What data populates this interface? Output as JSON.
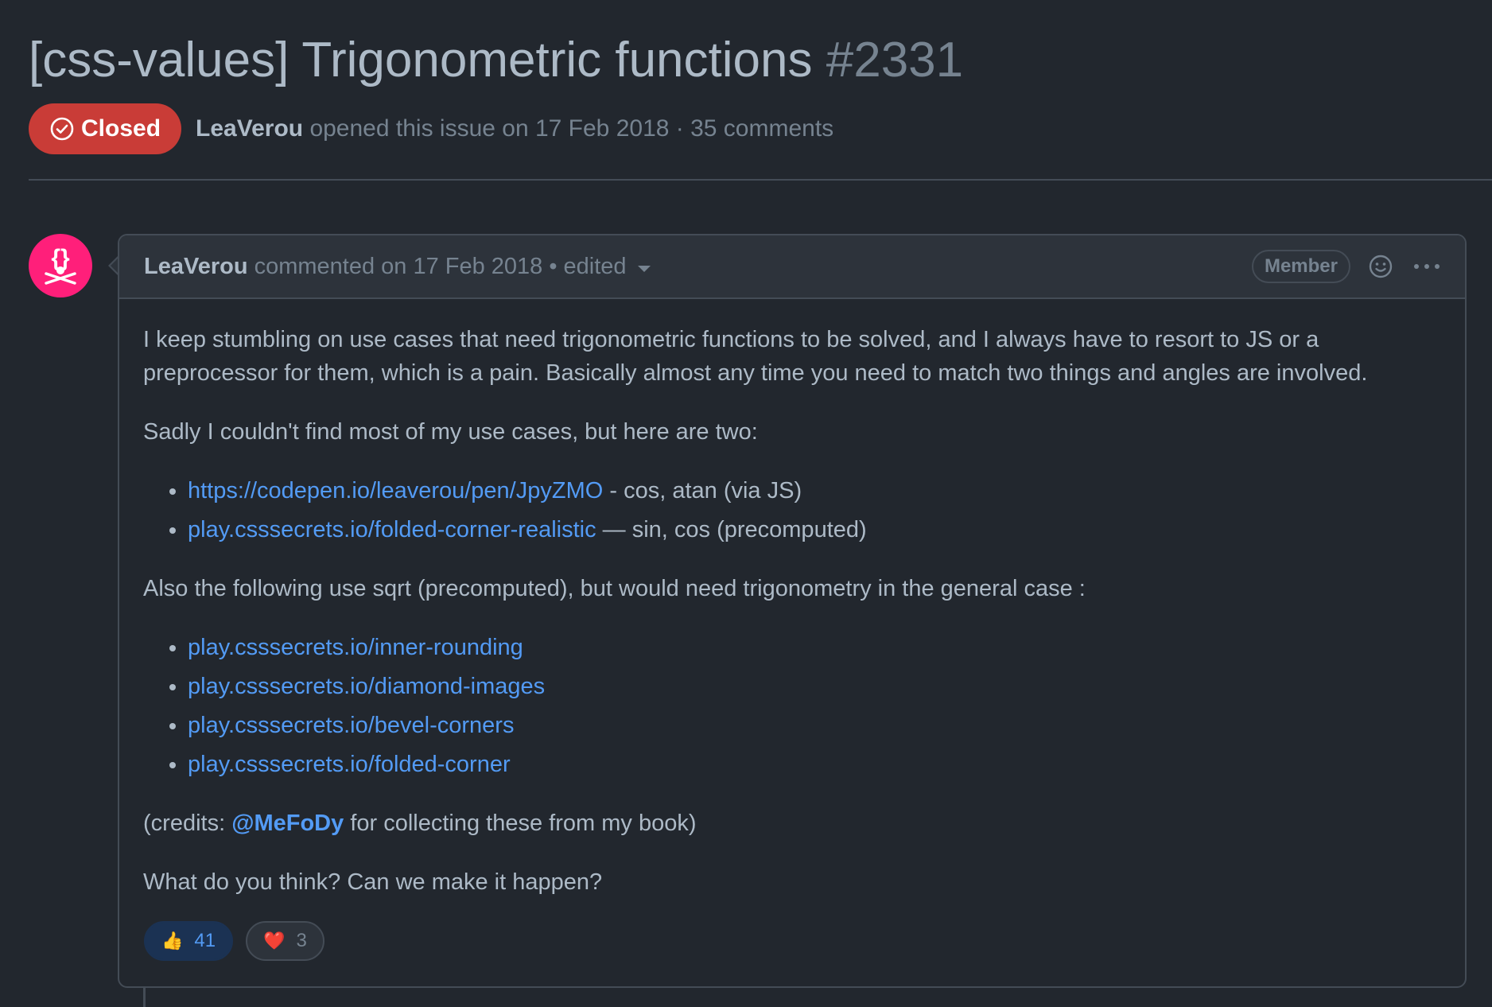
{
  "issue": {
    "title": "[css-values] Trigonometric functions",
    "number": "#2331",
    "state_label": "Closed",
    "author": "LeaVerou",
    "meta_text": "opened this issue on 17 Feb 2018 · 35 comments"
  },
  "comment": {
    "author": "LeaVerou",
    "timestamp": "commented on 17 Feb 2018",
    "edited_label": "• edited",
    "role_badge": "Member",
    "paragraph_1": "I keep stumbling on use cases that need trigonometric functions to be solved, and I always have to resort to JS or a preprocessor for them, which is a pain. Basically almost any time you need to match two things and angles are involved.",
    "paragraph_2": "Sadly I couldn't find most of my use cases, but here are two:",
    "list_1": [
      {
        "link": "https://codepen.io/leaverou/pen/JpyZMO",
        "note": " - cos, atan (via JS)"
      },
      {
        "link": "play.csssecrets.io/folded-corner-realistic",
        "note": " — sin, cos (precomputed)"
      }
    ],
    "paragraph_3": "Also the following use sqrt (precomputed), but would need trigonometry in the general case :",
    "list_2": [
      "play.csssecrets.io/inner-rounding",
      "play.csssecrets.io/diamond-images",
      "play.csssecrets.io/bevel-corners",
      "play.csssecrets.io/folded-corner"
    ],
    "credits_prefix": "(credits: ",
    "credits_mention": "@MeFoDy",
    "credits_suffix": " for collecting these from my book)",
    "paragraph_5": "What do you think? Can we make it happen?",
    "reactions": [
      {
        "emoji": "👍",
        "count": "41",
        "active": true
      },
      {
        "emoji": "❤️",
        "count": "3",
        "active": false
      }
    ]
  },
  "icons": {
    "state": "check-circle-icon",
    "avatar": "css-logo-avatar",
    "react": "smiley-icon",
    "more": "kebab-horizontal-icon",
    "edited_dropdown": "triangle-down-icon"
  },
  "colors": {
    "background": "#22272e",
    "closed_badge": "#c93c37",
    "link": "#539bf5",
    "avatar": "#ff1f7a"
  }
}
